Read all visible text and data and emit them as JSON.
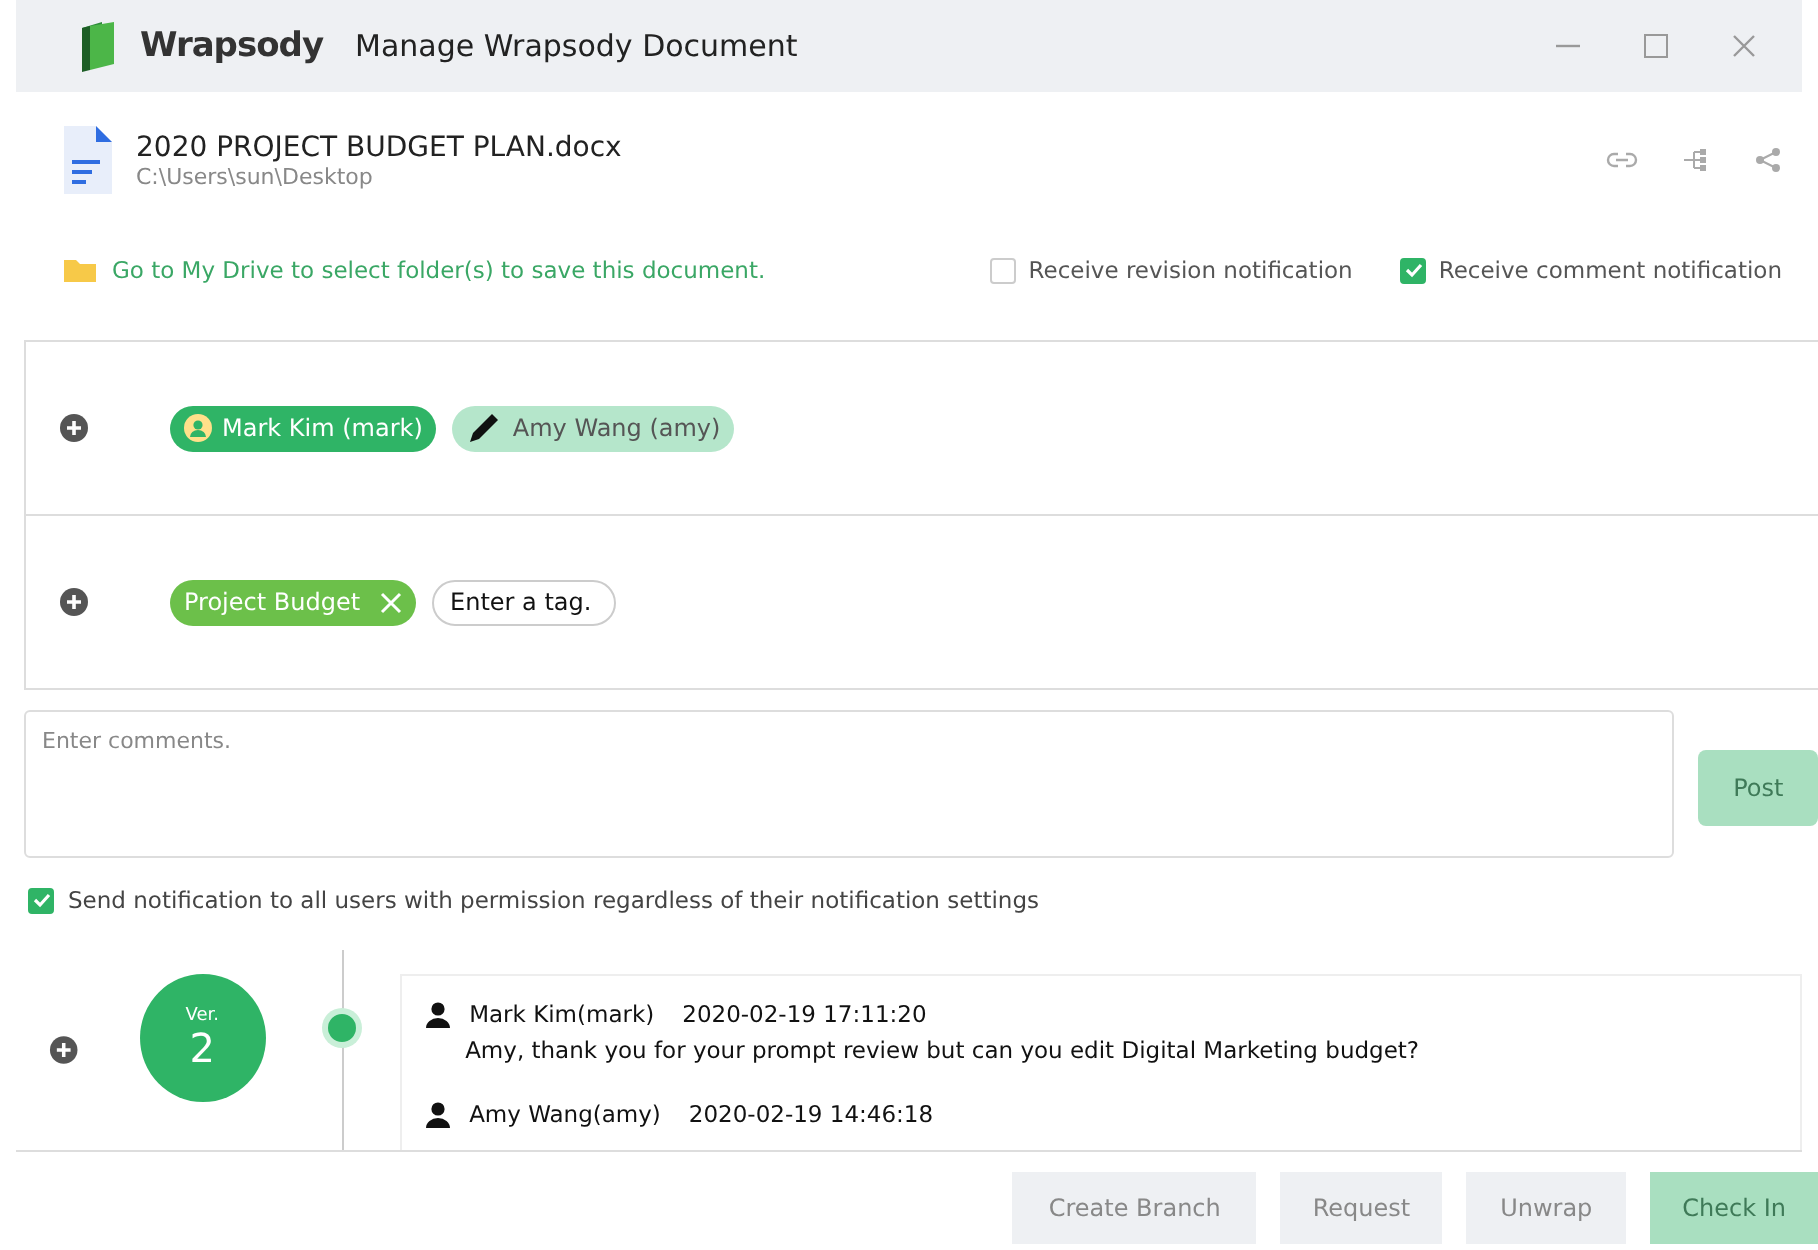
{
  "window": {
    "app_name": "Wrapsody",
    "title": "Manage Wrapsody Document"
  },
  "document": {
    "name": "2020 PROJECT BUDGET PLAN.docx",
    "path": "C:\\Users\\sun\\Desktop"
  },
  "drive_link": "Go to My Drive to select folder(s) to save this document.",
  "notifications": [
    {
      "label": "Receive revision notification",
      "checked": false
    },
    {
      "label": "Receive comment notification",
      "checked": true
    }
  ],
  "permissions": [
    {
      "name": "Mark Kim (mark)",
      "kind": "owner"
    },
    {
      "name": "Amy Wang (amy)",
      "kind": "editor"
    }
  ],
  "tags": [
    {
      "label": "Project Budget"
    }
  ],
  "tag_input": {
    "placeholder": "Enter a tag."
  },
  "comment": {
    "placeholder": "Enter comments.",
    "post": "Post",
    "post_disabled": true
  },
  "notify_all": {
    "label": "Send notification to all users with permission regardless of their notification settings",
    "checked": true
  },
  "versions": [
    {
      "label": "Ver.",
      "number": "2",
      "comments": [
        {
          "author": "Mark Kim(mark)",
          "time": "2020-02-19 17:11:20",
          "text": "Amy, thank you for your prompt review but can you edit Digital Marketing budget?"
        },
        {
          "author": "Amy Wang(amy)",
          "time": "2020-02-19 14:46:18"
        }
      ]
    }
  ],
  "buttons": [
    {
      "label": "Create Branch",
      "disabled": false
    },
    {
      "label": "Request",
      "disabled": false
    },
    {
      "label": "Unwrap",
      "disabled": false
    },
    {
      "label": "Check In",
      "disabled": true
    }
  ]
}
